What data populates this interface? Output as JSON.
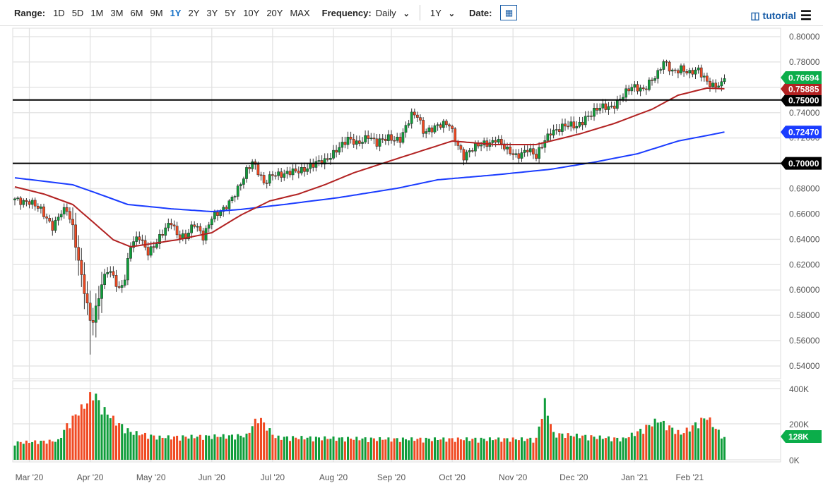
{
  "toolbar": {
    "range_label": "Range:",
    "ranges": [
      "1D",
      "5D",
      "1M",
      "3M",
      "6M",
      "9M",
      "1Y",
      "2Y",
      "3Y",
      "5Y",
      "10Y",
      "20Y",
      "MAX"
    ],
    "active_range": "1Y",
    "frequency_label": "Frequency:",
    "frequency_value": "Daily",
    "period_value": "1Y",
    "date_label": "Date:",
    "tutorial_label": "tutorial"
  },
  "chart_data": {
    "type": "candlestick",
    "price_axis": {
      "ticks": [
        "0.80000",
        "0.78000",
        "0.76000",
        "0.74000",
        "0.72000",
        "0.70000",
        "0.68000",
        "0.66000",
        "0.64000",
        "0.62000",
        "0.60000",
        "0.58000",
        "0.56000",
        "0.54000"
      ],
      "range": [
        0.53,
        0.81
      ]
    },
    "volume_axis": {
      "ticks": [
        "400K",
        "200K",
        "0K"
      ],
      "range": [
        0,
        400000
      ]
    },
    "x_labels": [
      "Mar '20",
      "Apr '20",
      "May '20",
      "Jun '20",
      "Jul '20",
      "Aug '20",
      "Sep '20",
      "Oct '20",
      "Nov '20",
      "Dec '20",
      "Jan '21",
      "Feb '21"
    ],
    "x_label_day_index": [
      5,
      26,
      47,
      68,
      89,
      110,
      130,
      151,
      172,
      193,
      214,
      233
    ],
    "trading_days": 246,
    "close_anchors": [
      [
        0,
        0.672
      ],
      [
        5,
        0.67
      ],
      [
        9,
        0.662
      ],
      [
        13,
        0.651
      ],
      [
        16,
        0.662
      ],
      [
        18,
        0.662
      ],
      [
        20,
        0.648
      ],
      [
        22,
        0.623
      ],
      [
        24,
        0.601
      ],
      [
        26,
        0.577
      ],
      [
        27,
        0.576
      ],
      [
        28,
        0.584
      ],
      [
        30,
        0.603
      ],
      [
        32,
        0.616
      ],
      [
        34,
        0.612
      ],
      [
        36,
        0.601
      ],
      [
        38,
        0.609
      ],
      [
        40,
        0.634
      ],
      [
        43,
        0.642
      ],
      [
        46,
        0.631
      ],
      [
        49,
        0.637
      ],
      [
        54,
        0.654
      ],
      [
        56,
        0.645
      ],
      [
        59,
        0.642
      ],
      [
        62,
        0.651
      ],
      [
        65,
        0.642
      ],
      [
        68,
        0.659
      ],
      [
        72,
        0.662
      ],
      [
        74,
        0.668
      ],
      [
        77,
        0.681
      ],
      [
        80,
        0.695
      ],
      [
        82,
        0.7
      ],
      [
        86,
        0.684
      ],
      [
        89,
        0.693
      ],
      [
        93,
        0.69
      ],
      [
        98,
        0.695
      ],
      [
        102,
        0.698
      ],
      [
        107,
        0.701
      ],
      [
        111,
        0.712
      ],
      [
        115,
        0.718
      ],
      [
        118,
        0.715
      ],
      [
        122,
        0.723
      ],
      [
        125,
        0.715
      ],
      [
        129,
        0.72
      ],
      [
        133,
        0.72
      ],
      [
        137,
        0.737
      ],
      [
        139,
        0.737
      ],
      [
        141,
        0.726
      ],
      [
        145,
        0.729
      ],
      [
        150,
        0.73
      ],
      [
        152,
        0.72
      ],
      [
        155,
        0.706
      ],
      [
        157,
        0.709
      ],
      [
        161,
        0.715
      ],
      [
        165,
        0.718
      ],
      [
        166,
        0.72
      ],
      [
        170,
        0.709
      ],
      [
        173,
        0.706
      ],
      [
        177,
        0.712
      ],
      [
        180,
        0.704
      ],
      [
        183,
        0.718
      ],
      [
        185,
        0.726
      ],
      [
        190,
        0.729
      ],
      [
        194,
        0.729
      ],
      [
        197,
        0.737
      ],
      [
        202,
        0.743
      ],
      [
        206,
        0.745
      ],
      [
        210,
        0.754
      ],
      [
        213,
        0.759
      ],
      [
        217,
        0.759
      ],
      [
        219,
        0.765
      ],
      [
        222,
        0.77
      ],
      [
        224,
        0.779
      ],
      [
        227,
        0.773
      ],
      [
        230,
        0.776
      ],
      [
        233,
        0.77
      ],
      [
        236,
        0.773
      ],
      [
        238,
        0.768
      ],
      [
        241,
        0.762
      ],
      [
        244,
        0.761
      ],
      [
        245,
        0.76694
      ]
    ],
    "low_extreme": 0.549,
    "ma50_anchors": [
      [
        0,
        0.6814
      ],
      [
        10,
        0.6758
      ],
      [
        20,
        0.6675
      ],
      [
        27,
        0.6536
      ],
      [
        34,
        0.6396
      ],
      [
        40,
        0.6341
      ],
      [
        56,
        0.6396
      ],
      [
        68,
        0.6452
      ],
      [
        78,
        0.6591
      ],
      [
        88,
        0.6703
      ],
      [
        98,
        0.6758
      ],
      [
        107,
        0.6831
      ],
      [
        117,
        0.6925
      ],
      [
        132,
        0.7037
      ],
      [
        151,
        0.7176
      ],
      [
        166,
        0.7148
      ],
      [
        180,
        0.7148
      ],
      [
        195,
        0.7232
      ],
      [
        207,
        0.7315
      ],
      [
        220,
        0.7427
      ],
      [
        229,
        0.7538
      ],
      [
        239,
        0.7594
      ],
      [
        245,
        0.75885
      ]
    ],
    "ma200_anchors": [
      [
        0,
        0.6886
      ],
      [
        20,
        0.6831
      ],
      [
        29,
        0.6758
      ],
      [
        39,
        0.6675
      ],
      [
        54,
        0.6641
      ],
      [
        68,
        0.6619
      ],
      [
        78,
        0.6636
      ],
      [
        93,
        0.6675
      ],
      [
        112,
        0.673
      ],
      [
        132,
        0.6803
      ],
      [
        146,
        0.687
      ],
      [
        166,
        0.6909
      ],
      [
        185,
        0.6953
      ],
      [
        200,
        0.7009
      ],
      [
        215,
        0.7076
      ],
      [
        229,
        0.7176
      ],
      [
        239,
        0.722
      ],
      [
        245,
        0.7247
      ]
    ],
    "volume_anchors": [
      [
        0,
        100000
      ],
      [
        15,
        110000
      ],
      [
        18,
        200000
      ],
      [
        22,
        280000
      ],
      [
        25,
        330000
      ],
      [
        27,
        400000
      ],
      [
        30,
        300000
      ],
      [
        35,
        220000
      ],
      [
        40,
        160000
      ],
      [
        50,
        130000
      ],
      [
        80,
        140000
      ],
      [
        84,
        250000
      ],
      [
        90,
        130000
      ],
      [
        130,
        120000
      ],
      [
        180,
        120000
      ],
      [
        183,
        330000
      ],
      [
        186,
        150000
      ],
      [
        210,
        120000
      ],
      [
        216,
        170000
      ],
      [
        222,
        230000
      ],
      [
        230,
        150000
      ],
      [
        239,
        250000
      ],
      [
        242,
        180000
      ],
      [
        245,
        128000
      ]
    ],
    "horizontal_levels": [
      "0.75000",
      "0.70000"
    ],
    "tags": {
      "last_price": "0.76694",
      "ma50": "0.75885",
      "ma200": "0.72470",
      "level1": "0.75000",
      "level2": "0.70000",
      "volume": "128K"
    },
    "colors": {
      "up": "#0f9d3a",
      "down": "#f04a23",
      "ma50": "#b22222",
      "ma200": "#1a3cff",
      "tag_up": "#0bad4a",
      "tag_ma200": "#1a3cff",
      "level": "#000000"
    }
  }
}
